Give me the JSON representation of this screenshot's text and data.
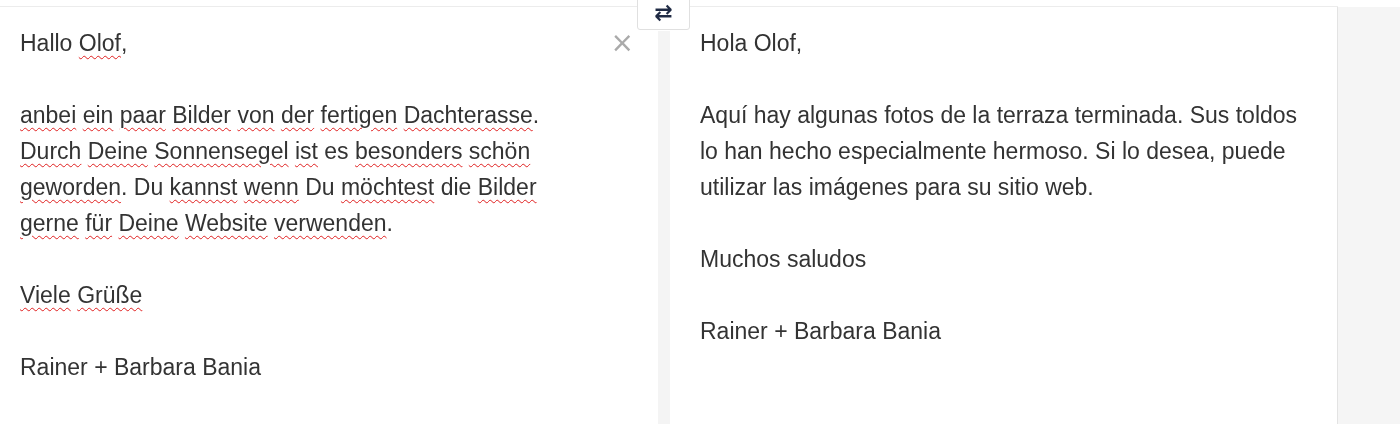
{
  "swap_button": {
    "label": "⇄"
  },
  "source": {
    "close_label": "×",
    "paragraphs": [
      [
        {
          "text": "Hallo",
          "misspelled": false
        },
        {
          "text": "Olof",
          "misspelled": true,
          "trail": ","
        }
      ],
      [
        {
          "text": "anbei",
          "misspelled": true
        },
        {
          "text": "ein",
          "misspelled": true
        },
        {
          "text": "paar",
          "misspelled": true
        },
        {
          "text": "Bilder",
          "misspelled": true
        },
        {
          "text": "von",
          "misspelled": true
        },
        {
          "text": "der",
          "misspelled": true
        },
        {
          "text": "fertigen",
          "misspelled": true
        },
        {
          "text": "Dachterasse",
          "misspelled": true,
          "trail": "."
        },
        {
          "text": "Durch",
          "misspelled": true
        },
        {
          "text": "Deine",
          "misspelled": true
        },
        {
          "text": "Sonnensegel",
          "misspelled": true
        },
        {
          "text": "ist",
          "misspelled": true
        },
        {
          "text": "es",
          "misspelled": false
        },
        {
          "text": "besonders",
          "misspelled": true
        },
        {
          "text": "schön",
          "misspelled": true
        },
        {
          "text": "geworden",
          "misspelled": true,
          "trail": "."
        },
        {
          "text": "Du",
          "misspelled": false
        },
        {
          "text": "kannst",
          "misspelled": true
        },
        {
          "text": "wenn",
          "misspelled": true
        },
        {
          "text": "Du",
          "misspelled": false
        },
        {
          "text": "möchtest",
          "misspelled": true
        },
        {
          "text": "die",
          "misspelled": false
        },
        {
          "text": "Bilder",
          "misspelled": true
        },
        {
          "text": "gerne",
          "misspelled": true
        },
        {
          "text": "für",
          "misspelled": true
        },
        {
          "text": "Deine",
          "misspelled": true
        },
        {
          "text": "Website",
          "misspelled": true
        },
        {
          "text": "verwenden",
          "misspelled": true,
          "trail": "."
        }
      ],
      [
        {
          "text": "Viele",
          "misspelled": true
        },
        {
          "text": "Grüße",
          "misspelled": true
        }
      ],
      [
        {
          "text": "Rainer + Barbara Bania",
          "misspelled": false
        }
      ]
    ]
  },
  "translation": {
    "paragraphs": [
      "Hola Olof,",
      "Aquí hay algunas fotos de la terraza terminada. Sus toldos lo han hecho especialmente hermoso. Si lo desea, puede utilizar las imágenes para su sitio web.",
      "Muchos saludos",
      "Rainer + Barbara Bania"
    ]
  }
}
